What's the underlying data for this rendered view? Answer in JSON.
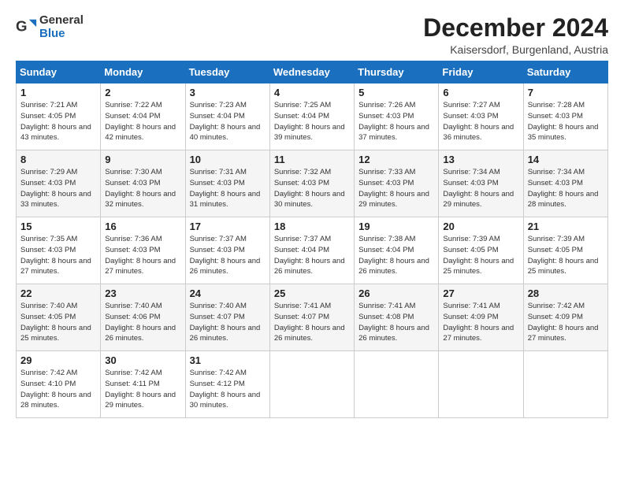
{
  "logo": {
    "general": "General",
    "blue": "Blue"
  },
  "title": "December 2024",
  "subtitle": "Kaisersdorf, Burgenland, Austria",
  "weekdays": [
    "Sunday",
    "Monday",
    "Tuesday",
    "Wednesday",
    "Thursday",
    "Friday",
    "Saturday"
  ],
  "weeks": [
    [
      {
        "day": "1",
        "sunrise": "7:21 AM",
        "sunset": "4:05 PM",
        "daylight": "8 hours and 43 minutes."
      },
      {
        "day": "2",
        "sunrise": "7:22 AM",
        "sunset": "4:04 PM",
        "daylight": "8 hours and 42 minutes."
      },
      {
        "day": "3",
        "sunrise": "7:23 AM",
        "sunset": "4:04 PM",
        "daylight": "8 hours and 40 minutes."
      },
      {
        "day": "4",
        "sunrise": "7:25 AM",
        "sunset": "4:04 PM",
        "daylight": "8 hours and 39 minutes."
      },
      {
        "day": "5",
        "sunrise": "7:26 AM",
        "sunset": "4:03 PM",
        "daylight": "8 hours and 37 minutes."
      },
      {
        "day": "6",
        "sunrise": "7:27 AM",
        "sunset": "4:03 PM",
        "daylight": "8 hours and 36 minutes."
      },
      {
        "day": "7",
        "sunrise": "7:28 AM",
        "sunset": "4:03 PM",
        "daylight": "8 hours and 35 minutes."
      }
    ],
    [
      {
        "day": "8",
        "sunrise": "7:29 AM",
        "sunset": "4:03 PM",
        "daylight": "8 hours and 33 minutes."
      },
      {
        "day": "9",
        "sunrise": "7:30 AM",
        "sunset": "4:03 PM",
        "daylight": "8 hours and 32 minutes."
      },
      {
        "day": "10",
        "sunrise": "7:31 AM",
        "sunset": "4:03 PM",
        "daylight": "8 hours and 31 minutes."
      },
      {
        "day": "11",
        "sunrise": "7:32 AM",
        "sunset": "4:03 PM",
        "daylight": "8 hours and 30 minutes."
      },
      {
        "day": "12",
        "sunrise": "7:33 AM",
        "sunset": "4:03 PM",
        "daylight": "8 hours and 29 minutes."
      },
      {
        "day": "13",
        "sunrise": "7:34 AM",
        "sunset": "4:03 PM",
        "daylight": "8 hours and 29 minutes."
      },
      {
        "day": "14",
        "sunrise": "7:34 AM",
        "sunset": "4:03 PM",
        "daylight": "8 hours and 28 minutes."
      }
    ],
    [
      {
        "day": "15",
        "sunrise": "7:35 AM",
        "sunset": "4:03 PM",
        "daylight": "8 hours and 27 minutes."
      },
      {
        "day": "16",
        "sunrise": "7:36 AM",
        "sunset": "4:03 PM",
        "daylight": "8 hours and 27 minutes."
      },
      {
        "day": "17",
        "sunrise": "7:37 AM",
        "sunset": "4:03 PM",
        "daylight": "8 hours and 26 minutes."
      },
      {
        "day": "18",
        "sunrise": "7:37 AM",
        "sunset": "4:04 PM",
        "daylight": "8 hours and 26 minutes."
      },
      {
        "day": "19",
        "sunrise": "7:38 AM",
        "sunset": "4:04 PM",
        "daylight": "8 hours and 26 minutes."
      },
      {
        "day": "20",
        "sunrise": "7:39 AM",
        "sunset": "4:05 PM",
        "daylight": "8 hours and 25 minutes."
      },
      {
        "day": "21",
        "sunrise": "7:39 AM",
        "sunset": "4:05 PM",
        "daylight": "8 hours and 25 minutes."
      }
    ],
    [
      {
        "day": "22",
        "sunrise": "7:40 AM",
        "sunset": "4:05 PM",
        "daylight": "8 hours and 25 minutes."
      },
      {
        "day": "23",
        "sunrise": "7:40 AM",
        "sunset": "4:06 PM",
        "daylight": "8 hours and 26 minutes."
      },
      {
        "day": "24",
        "sunrise": "7:40 AM",
        "sunset": "4:07 PM",
        "daylight": "8 hours and 26 minutes."
      },
      {
        "day": "25",
        "sunrise": "7:41 AM",
        "sunset": "4:07 PM",
        "daylight": "8 hours and 26 minutes."
      },
      {
        "day": "26",
        "sunrise": "7:41 AM",
        "sunset": "4:08 PM",
        "daylight": "8 hours and 26 minutes."
      },
      {
        "day": "27",
        "sunrise": "7:41 AM",
        "sunset": "4:09 PM",
        "daylight": "8 hours and 27 minutes."
      },
      {
        "day": "28",
        "sunrise": "7:42 AM",
        "sunset": "4:09 PM",
        "daylight": "8 hours and 27 minutes."
      }
    ],
    [
      {
        "day": "29",
        "sunrise": "7:42 AM",
        "sunset": "4:10 PM",
        "daylight": "8 hours and 28 minutes."
      },
      {
        "day": "30",
        "sunrise": "7:42 AM",
        "sunset": "4:11 PM",
        "daylight": "8 hours and 29 minutes."
      },
      {
        "day": "31",
        "sunrise": "7:42 AM",
        "sunset": "4:12 PM",
        "daylight": "8 hours and 30 minutes."
      },
      null,
      null,
      null,
      null
    ]
  ],
  "labels": {
    "sunrise": "Sunrise:",
    "sunset": "Sunset:",
    "daylight": "Daylight:"
  }
}
